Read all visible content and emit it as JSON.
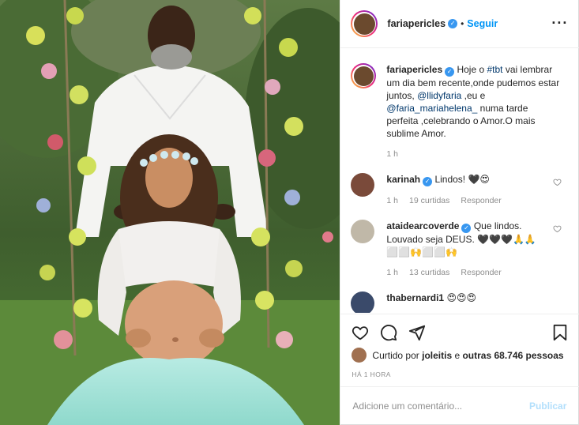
{
  "post": {
    "username": "fariapericles",
    "verified_mark": "✓",
    "separator": "•",
    "follow_label": "Seguir",
    "more_icon": "more-options-icon"
  },
  "caption": {
    "username": "fariapericles",
    "text_1": "Hoje o ",
    "hashtag": "#tbt",
    "text_2": " vai lembrar um dia bem recente,onde pudemos estar juntos, ",
    "mention_1": "@llidyfaria",
    "text_3": " ,eu e ",
    "mention_2": "@faria_mariahelena_",
    "text_4": " numa tarde perfeita ,celebrando o Amor.O mais sublime Amor.",
    "time": "1 h"
  },
  "comments": [
    {
      "username": "karinah",
      "text": "Lindos! 🖤😍",
      "time": "1 h",
      "likes": "19 curtidas",
      "reply": "Responder"
    },
    {
      "username": "ataidearcoverde",
      "text": "Que lindos. Louvado seja DEUS. 🖤🖤🖤🙏🙏 ⬜⬜🙌⬜⬜🙌",
      "time": "1 h",
      "likes": "13 curtidas",
      "reply": "Responder"
    },
    {
      "username": "thabernardi1",
      "text": "😍😍😍"
    }
  ],
  "likes": {
    "prefix": "Curtido por ",
    "user": "joleitis",
    "middle": " e ",
    "others": "outras 68.746 pessoas"
  },
  "time_ago": "HÁ 1 HORA",
  "add_comment": {
    "placeholder": "Adicione um comentário...",
    "publish_label": "Publicar"
  },
  "colors": {
    "link": "#0095f6",
    "mention": "#00376b",
    "verified": "#3897f0",
    "publish_disabled": "#b2dffc",
    "muted": "#8e8e8e"
  },
  "icons": [
    "heart-icon",
    "comment-icon",
    "share-icon",
    "bookmark-icon",
    "verified-icon"
  ]
}
